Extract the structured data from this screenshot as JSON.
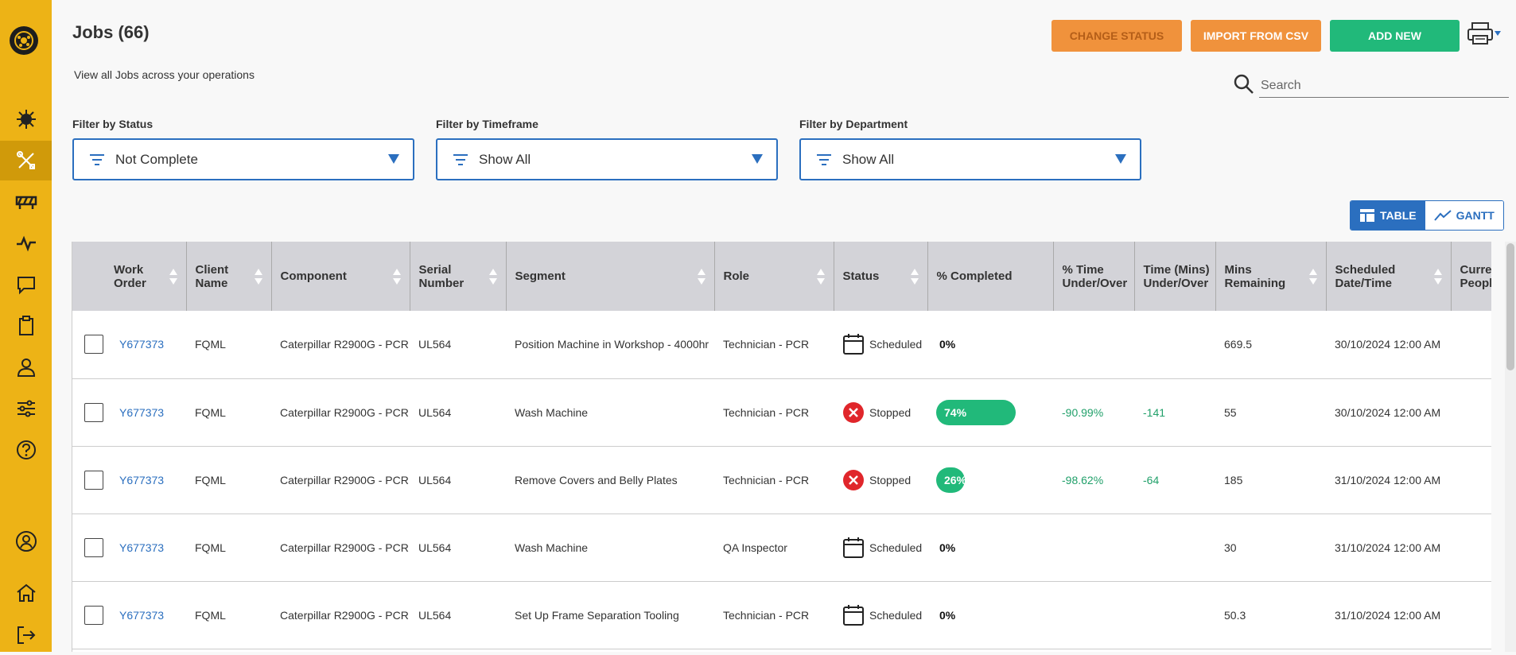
{
  "page": {
    "title": "Jobs (66)",
    "subtitle": "View all Jobs across your operations"
  },
  "toolbar": {
    "change_status": "CHANGE STATUS",
    "import_csv": "IMPORT FROM CSV",
    "add_new": "ADD NEW"
  },
  "search": {
    "placeholder": "Search",
    "value": ""
  },
  "filters": {
    "status": {
      "label": "Filter by Status",
      "value": "Not Complete"
    },
    "timeframe": {
      "label": "Filter by Timeframe",
      "value": "Show All"
    },
    "department": {
      "label": "Filter by Department",
      "value": "Show All"
    }
  },
  "view_toggle": {
    "table": "TABLE",
    "gantt": "GANTT",
    "selected": "table"
  },
  "sidebar": {
    "items": [
      {
        "icon": "virus-icon"
      },
      {
        "icon": "tools-icon",
        "active": true
      },
      {
        "icon": "barrier-icon"
      },
      {
        "icon": "activity-icon"
      },
      {
        "icon": "chat-icon"
      },
      {
        "icon": "clipboard-icon"
      },
      {
        "icon": "user-icon"
      },
      {
        "icon": "sliders-icon"
      },
      {
        "icon": "help-icon"
      },
      {
        "icon": "account-icon"
      },
      {
        "icon": "home-icon"
      },
      {
        "icon": "logout-icon"
      }
    ]
  },
  "table": {
    "headers": {
      "work_order": "Work Order",
      "client_name": "Client Name",
      "component": "Component",
      "serial_number": "Serial Number",
      "segment": "Segment",
      "role": "Role",
      "status": "Status",
      "pct_completed": "% Completed",
      "pct_time": "% Time Under/Over",
      "time_mins": "Time (Mins) Under/Over",
      "mins_remaining": "Mins Remaining",
      "scheduled": "Scheduled Date/Time",
      "current_people": "Current People"
    },
    "rows": [
      {
        "work_order": "Y677373",
        "client": "FQML",
        "component": "Caterpillar R2900G - PCR",
        "serial": "UL564",
        "segment": "Position Machine in Workshop - 4000hr",
        "role": "Technician - PCR",
        "status": "Scheduled",
        "pct": "0%",
        "pct_value": 0,
        "pct_time": "",
        "time_mins": "",
        "mins_remaining": "669.5",
        "scheduled": "30/10/2024 12:00 AM"
      },
      {
        "work_order": "Y677373",
        "client": "FQML",
        "component": "Caterpillar R2900G - PCR",
        "serial": "UL564",
        "segment": "Wash Machine",
        "role": "Technician - PCR",
        "status": "Stopped",
        "pct": "74%",
        "pct_value": 74,
        "pct_time": "-90.99%",
        "time_mins": "-141",
        "mins_remaining": "55",
        "scheduled": "30/10/2024 12:00 AM"
      },
      {
        "work_order": "Y677373",
        "client": "FQML",
        "component": "Caterpillar R2900G - PCR",
        "serial": "UL564",
        "segment": "Remove Covers and Belly Plates",
        "role": "Technician - PCR",
        "status": "Stopped",
        "pct": "26%",
        "pct_value": 26,
        "pct_time": "-98.62%",
        "time_mins": "-64",
        "mins_remaining": "185",
        "scheduled": "31/10/2024 12:00 AM"
      },
      {
        "work_order": "Y677373",
        "client": "FQML",
        "component": "Caterpillar R2900G - PCR",
        "serial": "UL564",
        "segment": "Wash Machine",
        "role": "QA Inspector",
        "status": "Scheduled",
        "pct": "0%",
        "pct_value": 0,
        "pct_time": "",
        "time_mins": "",
        "mins_remaining": "30",
        "scheduled": "31/10/2024 12:00 AM"
      },
      {
        "work_order": "Y677373",
        "client": "FQML",
        "component": "Caterpillar R2900G - PCR",
        "serial": "UL564",
        "segment": "Set Up Frame Separation Tooling",
        "role": "Technician - PCR",
        "status": "Scheduled",
        "pct": "0%",
        "pct_value": 0,
        "pct_time": "",
        "time_mins": "",
        "mins_remaining": "50.3",
        "scheduled": "31/10/2024 12:00 AM"
      }
    ]
  },
  "colors": {
    "sidebar": "#edb316",
    "accent_blue": "#2b6fbf",
    "orange": "#f0923c",
    "green": "#21b97a",
    "stopped_red": "#e0262b"
  }
}
